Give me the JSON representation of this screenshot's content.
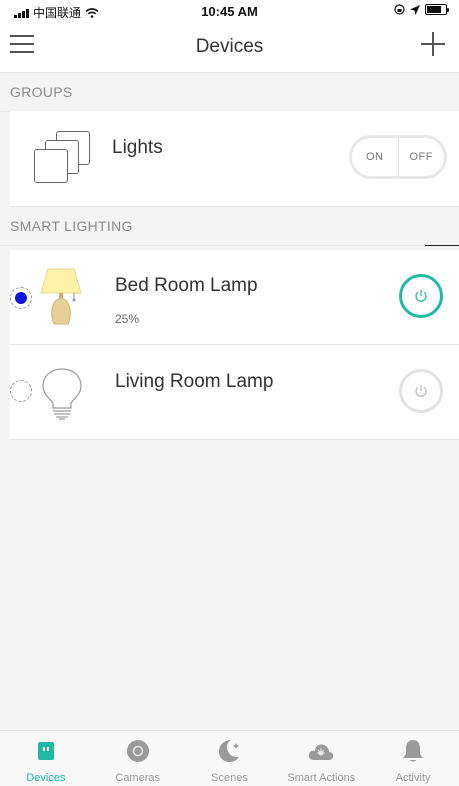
{
  "status_bar": {
    "carrier": "中国联通",
    "time": "10:45 AM"
  },
  "nav": {
    "title": "Devices"
  },
  "groups_section": {
    "header": "GROUPS",
    "items": [
      {
        "title": "Lights",
        "on_label": "ON",
        "off_label": "OFF",
        "icon": "lights-group-icon"
      }
    ]
  },
  "lighting_section": {
    "header": "SMART LIGHTING",
    "items": [
      {
        "title": "Bed Room Lamp",
        "subtitle": "25%",
        "icon": "table-lamp-icon",
        "selected": true,
        "power_on": true
      },
      {
        "title": "Living Room Lamp",
        "subtitle": "",
        "icon": "light-bulb-icon",
        "selected": false,
        "power_on": false
      }
    ]
  },
  "tabs": [
    {
      "label": "Devices",
      "icon": "devices-icon",
      "active": true
    },
    {
      "label": "Cameras",
      "icon": "camera-icon",
      "active": false
    },
    {
      "label": "Scenes",
      "icon": "moon-icon",
      "active": false
    },
    {
      "label": "Smart Actions",
      "icon": "cloud-sun-icon",
      "active": false
    },
    {
      "label": "Activity",
      "icon": "bell-icon",
      "active": false
    }
  ],
  "colors": {
    "accent": "#22b8a6",
    "selected_dot": "#0a12e0",
    "lamp_shade": "#fff2a8",
    "lamp_base": "#e2c890"
  }
}
